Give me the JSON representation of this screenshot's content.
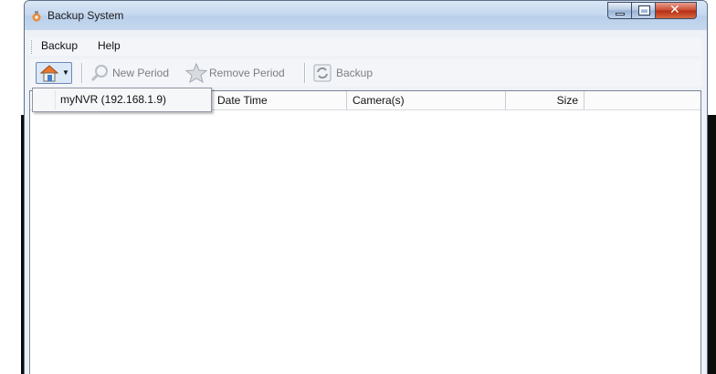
{
  "window": {
    "title": "Backup System"
  },
  "menu": {
    "items": [
      "Backup",
      "Help"
    ]
  },
  "toolbar": {
    "home_icon": "home-icon",
    "new_period_label": "New Period",
    "remove_period_label": "Remove Period",
    "backup_label": "Backup"
  },
  "dropdown": {
    "items": [
      "myNVR (192.168.1.9)"
    ]
  },
  "table": {
    "columns": [
      "",
      "Date Time",
      "Camera(s)",
      "Size",
      ""
    ],
    "rows": []
  },
  "colors": {
    "titlebar": "#c7d9ef",
    "close_button": "#c9482d",
    "window_bg": "#eef1f6"
  }
}
